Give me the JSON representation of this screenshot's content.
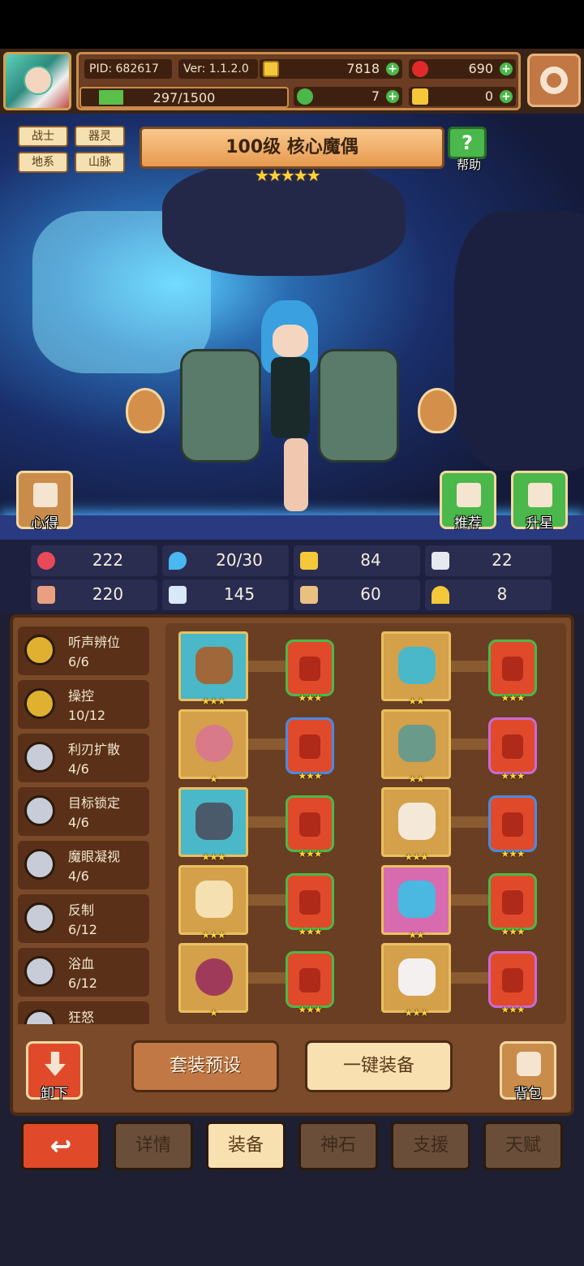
{
  "header": {
    "pid": "PID: 682617",
    "version": "Ver: 1.1.2.0",
    "gold": "7818",
    "gems": "690",
    "clovers": "7",
    "keys": "0",
    "stamina": "297/1500",
    "stamina_level": 0.2,
    "plus": "+"
  },
  "hero": {
    "tags": [
      "战士",
      "器灵",
      "地系",
      "山脉"
    ],
    "title": "100级 核心魔偶",
    "stars": "★★★★★",
    "help_label": "帮助",
    "notes_label": "心得",
    "recommend_label": "推荐",
    "starup_label": "升星"
  },
  "stats": [
    {
      "icon": "heart-icon",
      "value": "222"
    },
    {
      "icon": "mana-drop-icon",
      "value": "20/30"
    },
    {
      "icon": "shield-icon",
      "value": "84"
    },
    {
      "icon": "wing-icon",
      "value": "22"
    },
    {
      "icon": "fist-icon",
      "value": "220"
    },
    {
      "icon": "book-icon",
      "value": "145"
    },
    {
      "icon": "card-icon",
      "value": "60"
    },
    {
      "icon": "horseshoe-icon",
      "value": "8"
    }
  ],
  "skills": [
    {
      "name": "听声辨位",
      "count": "6/6",
      "tier": "gold"
    },
    {
      "name": "操控",
      "count": "10/12",
      "tier": "gold"
    },
    {
      "name": "利刃扩散",
      "count": "4/6",
      "tier": "silver"
    },
    {
      "name": "目标锁定",
      "count": "4/6",
      "tier": "silver"
    },
    {
      "name": "魔眼凝视",
      "count": "4/6",
      "tier": "silver"
    },
    {
      "name": "反制",
      "count": "6/12",
      "tier": "silver"
    },
    {
      "name": "浴血",
      "count": "6/12",
      "tier": "silver"
    },
    {
      "name": "狂怒",
      "count": "",
      "tier": "silver"
    }
  ],
  "equipment": {
    "three_stars": "★★★",
    "two_stars": "★★",
    "one_star": "★"
  },
  "actions": {
    "unload": "卸下",
    "preset": "套装预设",
    "one_click": "一键装备",
    "bag": "背包"
  },
  "tabs": {
    "back": "↩",
    "details": "详情",
    "equip": "装备",
    "godstone": "神石",
    "support": "支援",
    "talent": "天赋"
  },
  "colors": {
    "accent": "#e04a2a",
    "panel": "#7a4a2a",
    "gold": "#ffd23a"
  }
}
